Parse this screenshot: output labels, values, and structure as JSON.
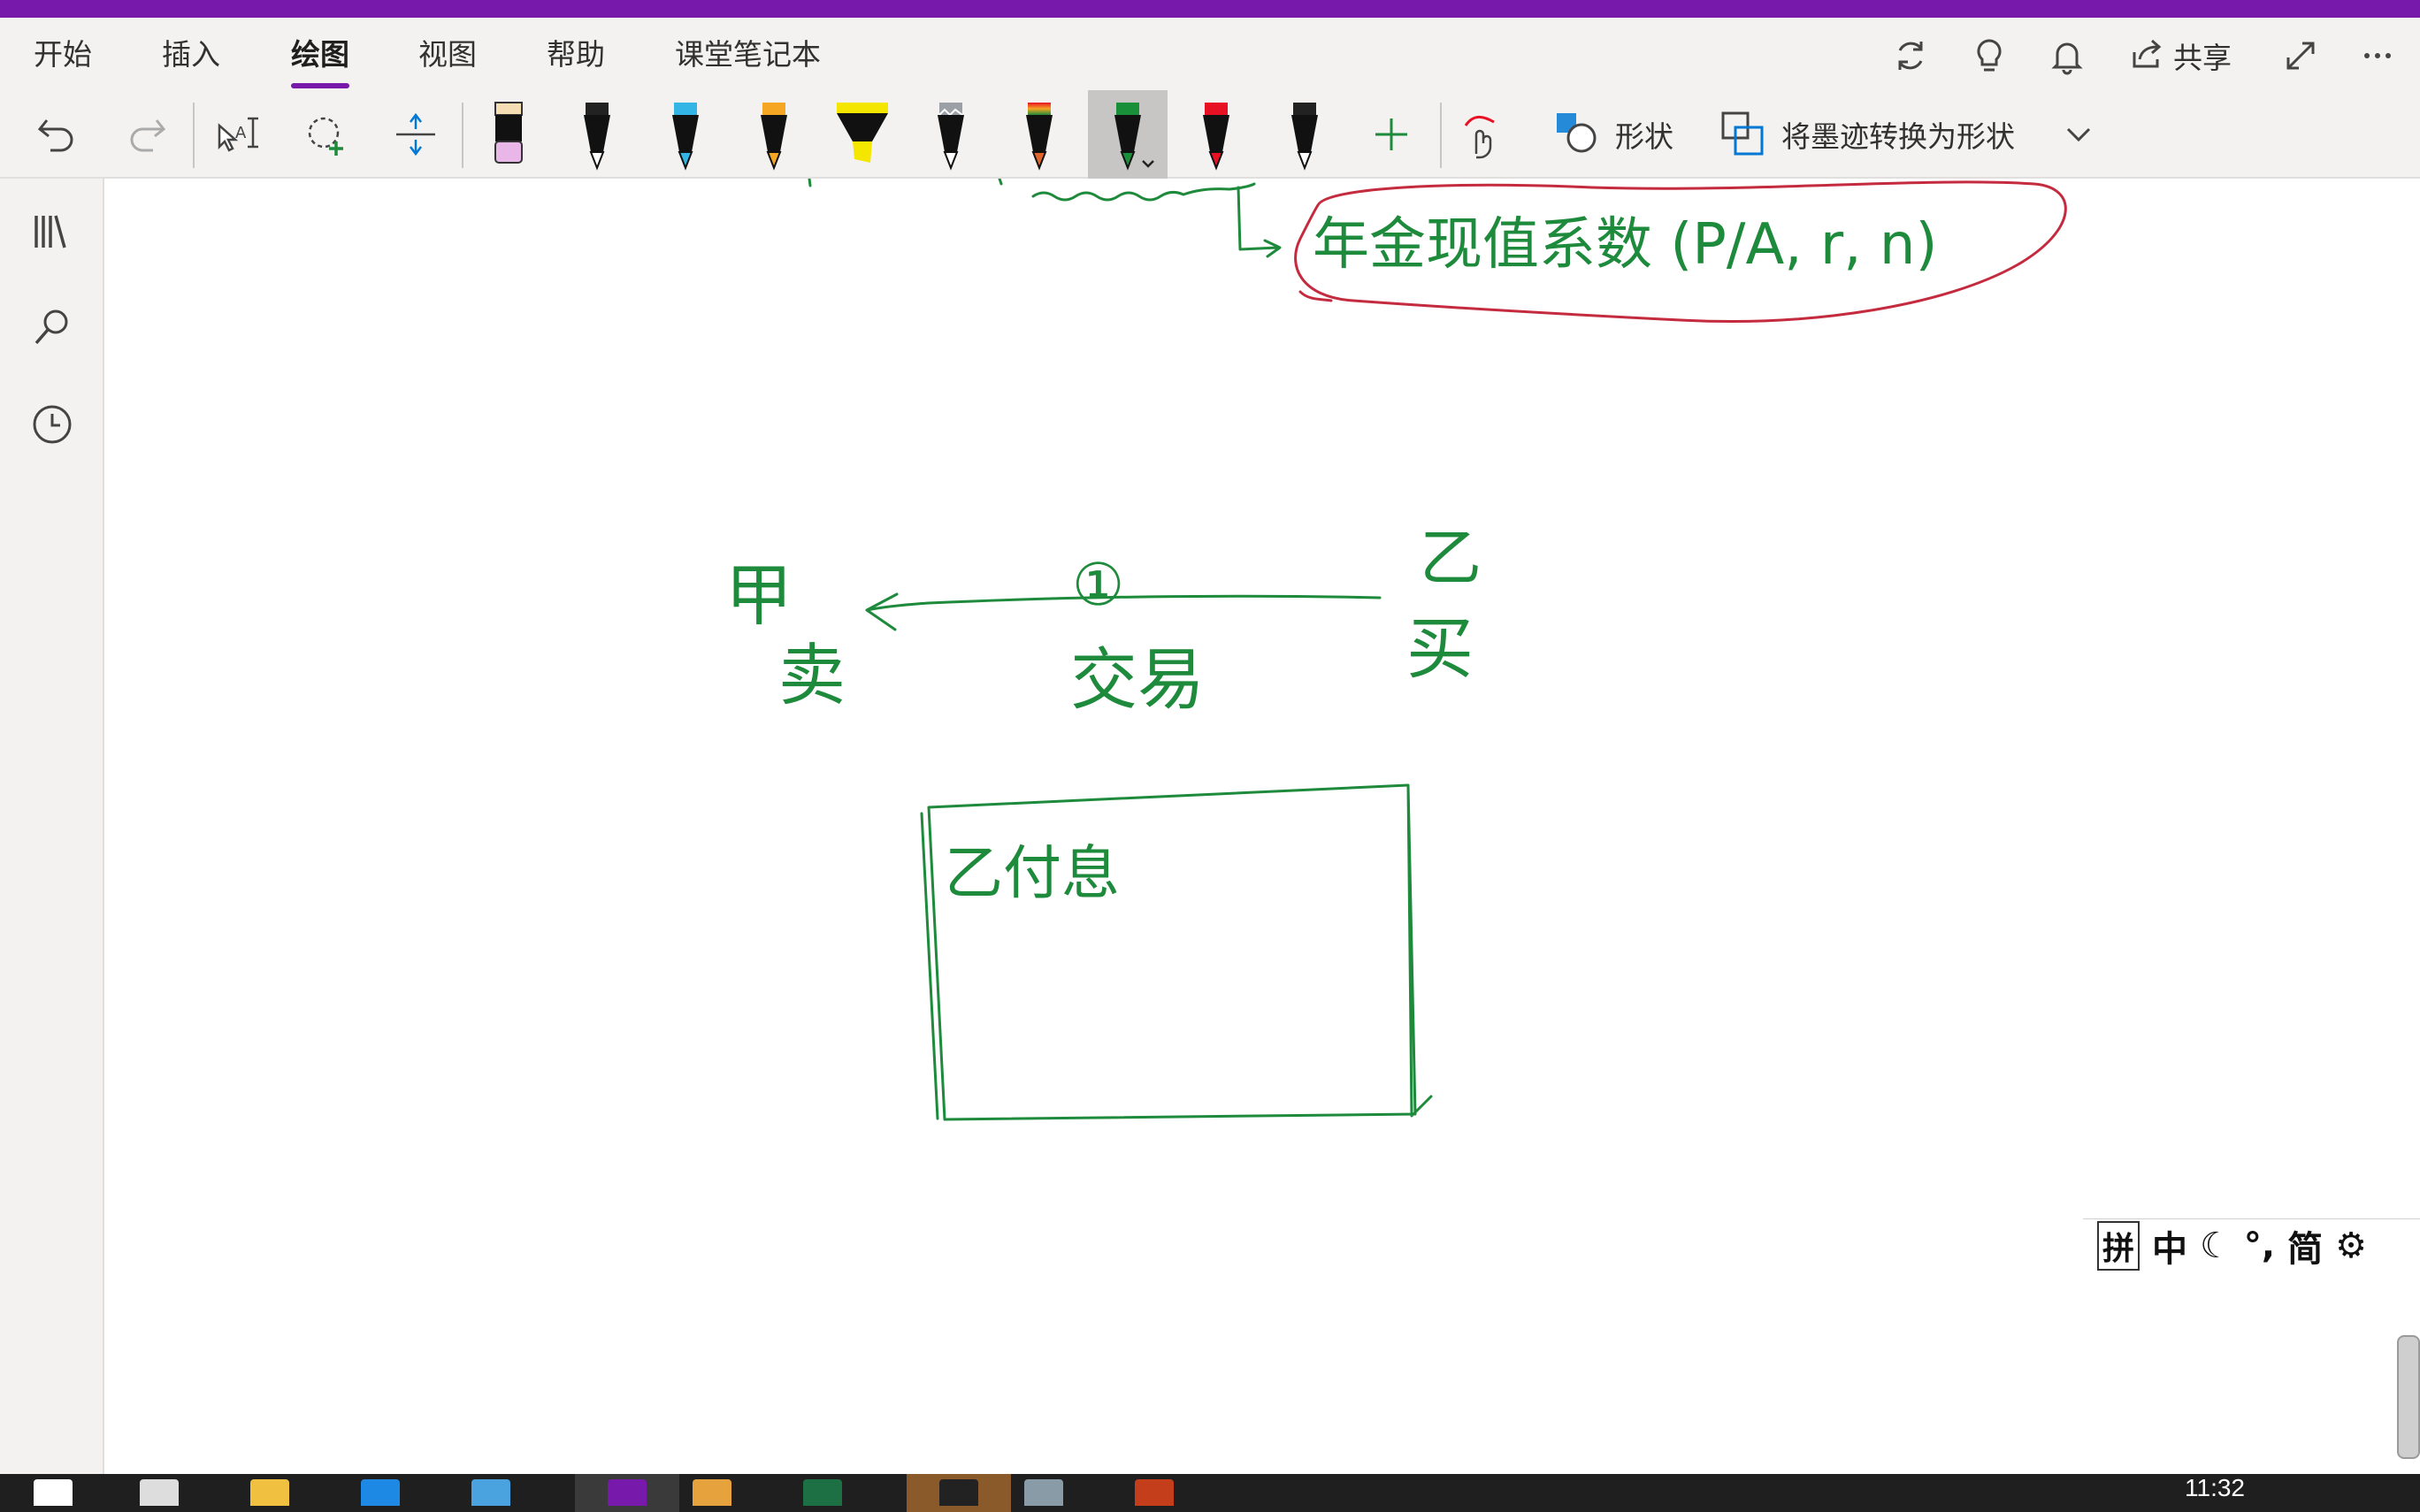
{
  "window": {
    "accent_color": "#7719aa"
  },
  "ribbon": {
    "tabs": [
      {
        "label": "开始"
      },
      {
        "label": "插入"
      },
      {
        "label": "绘图",
        "active": true
      },
      {
        "label": "视图"
      },
      {
        "label": "帮助"
      },
      {
        "label": "课堂笔记本"
      }
    ],
    "right_actions": {
      "sync_icon": "sync-icon",
      "idea_icon": "lightbulb-icon",
      "notifications_icon": "bell-icon",
      "share_label": "共享",
      "fullscreen_icon": "expand-icon",
      "more_icon": "more-icon"
    }
  },
  "draw_toolbar": {
    "undo_icon": "undo-icon",
    "redo_icon": "redo-icon",
    "type_select_icon": "type-select-icon",
    "lasso_icon": "lasso-select-icon",
    "add_space_icon": "insert-space-icon",
    "pens": [
      {
        "name": "eraser",
        "tip_color": "#e8b7e8"
      },
      {
        "name": "black-pen",
        "tip_color": "#222222"
      },
      {
        "name": "blue-pen",
        "tip_color": "#33b5e5"
      },
      {
        "name": "orange-pen",
        "tip_color": "#f5a623"
      },
      {
        "name": "yellow-highlighter",
        "tip_color": "#f5e600"
      },
      {
        "name": "galaxy-pen",
        "tip_color": "#9aa0a6"
      },
      {
        "name": "rainbow-pen",
        "tip_color": "#e0652a"
      },
      {
        "name": "green-pen",
        "tip_color": "#1a8f3a",
        "selected": true
      },
      {
        "name": "red-pen",
        "tip_color": "#e81123"
      },
      {
        "name": "black-pen-2",
        "tip_color": "#222222"
      }
    ],
    "add_pen_icon": "plus-icon",
    "touch_draw_icon": "touch-draw-icon",
    "shapes_label": "形状",
    "ink_to_shape_label": "将墨迹转换为形状",
    "overflow_icon": "chevron-down-icon"
  },
  "sidebar": {
    "notebooks_icon": "notebooks-icon",
    "search_icon": "search-icon",
    "recent_icon": "clock-icon"
  },
  "ink": {
    "stroke_color": "#1e8a3c",
    "highlight_circle_color": "#c42b3e",
    "handwriting": {
      "top_formula": "年金现值系数 (P/A, r, n)",
      "party_a": "甲",
      "sell": "卖",
      "party_b": "乙",
      "buy": "买",
      "circled_one": "①",
      "transaction": "交易",
      "box_note": "乙付息"
    }
  },
  "ime": {
    "cells": [
      "拼",
      "中",
      "☾",
      "°,",
      "简",
      "⚙"
    ]
  },
  "taskbar": {
    "apps": [
      {
        "name": "start",
        "color": "#ffffff"
      },
      {
        "name": "task-view",
        "color": "#dddddd"
      },
      {
        "name": "file-explorer",
        "color": "#f0c040"
      },
      {
        "name": "edge",
        "color": "#1e88e5"
      },
      {
        "name": "browser",
        "color": "#4aa3df"
      },
      {
        "name": "onenote",
        "color": "#7719aa",
        "active": true
      },
      {
        "name": "paint",
        "color": "#e6a23c"
      },
      {
        "name": "excel",
        "color": "#1d7044"
      },
      {
        "name": "qq",
        "color": "#222222",
        "active": true
      },
      {
        "name": "photos",
        "color": "#8a9ba8"
      },
      {
        "name": "powerpoint",
        "color": "#c43e1c"
      }
    ],
    "clock": "11:32"
  }
}
